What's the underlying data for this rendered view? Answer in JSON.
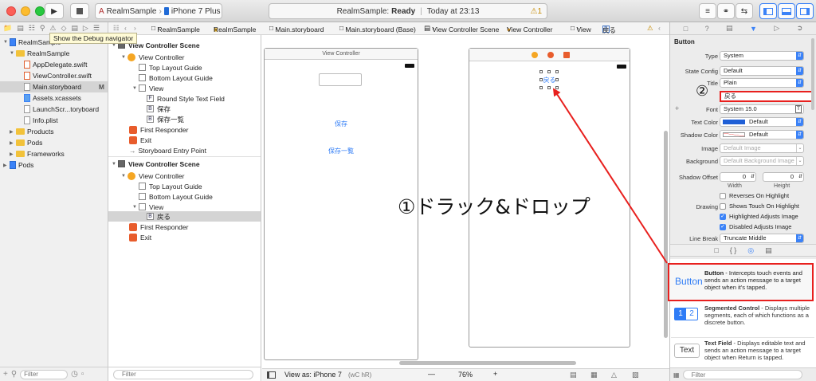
{
  "toolbar": {
    "scheme": "RealmSample",
    "device": "iPhone 7 Plus",
    "status_project": "RealmSample:",
    "status_state": "Ready",
    "status_sep": "|",
    "status_time": "Today at 23:13",
    "warnings": "1"
  },
  "tooltip": "Show the Debug navigator",
  "jumpbar": {
    "crumbs": [
      "RealmSample",
      "RealmSample",
      "Main.storyboard",
      "Main.storyboard (Base)",
      "View Controller Scene",
      "View Controller",
      "View",
      "戻る"
    ]
  },
  "navigator": {
    "items": [
      {
        "label": "RealmSample",
        "badge": ""
      },
      {
        "label": "RealmSample",
        "badge": ""
      },
      {
        "label": "AppDelegate.swift",
        "badge": ""
      },
      {
        "label": "ViewController.swift",
        "badge": ""
      },
      {
        "label": "Main.storyboard",
        "badge": "M"
      },
      {
        "label": "Assets.xcassets",
        "badge": ""
      },
      {
        "label": "LaunchScr...toryboard",
        "badge": ""
      },
      {
        "label": "Info.plist",
        "badge": ""
      },
      {
        "label": "Products",
        "badge": ""
      },
      {
        "label": "Pods",
        "badge": ""
      },
      {
        "label": "Frameworks",
        "badge": ""
      },
      {
        "label": "Pods",
        "badge": ""
      }
    ],
    "filter_placeholder": "Filter"
  },
  "outline": {
    "rows": [
      "View Controller Scene",
      "View Controller",
      "Top Layout Guide",
      "Bottom Layout Guide",
      "View",
      "Round Style Text Field",
      "保存",
      "保存一覧",
      "First Responder",
      "Exit",
      "Storyboard Entry Point",
      "View Controller Scene",
      "View Controller",
      "Top Layout Guide",
      "Bottom Layout Guide",
      "View",
      "戻る",
      "First Responder",
      "Exit"
    ],
    "filter_placeholder": "Filter"
  },
  "canvas": {
    "vc1_title": "View Controller",
    "btn_save": "保存",
    "btn_list": "保存一覧",
    "vc2_button": "戻る",
    "annotation_drag": "①ドラック&ドロップ",
    "annotation_two": "②"
  },
  "bottombar": {
    "view_as": "View as: iPhone 7",
    "view_as_keys": "(wC hR)",
    "minus": "—",
    "zoom": "76%",
    "plus": "+"
  },
  "inspector": {
    "section": "Button",
    "type_label": "Type",
    "type_value": "System",
    "state_label": "State Config",
    "state_value": "Default",
    "title_label": "Title",
    "title_value": "Plain",
    "title_text": "戻る",
    "font_label": "Font",
    "font_value": "System 15.0",
    "textcolor_label": "Text Color",
    "textcolor_value": "Default",
    "shadowcolor_label": "Shadow Color",
    "shadowcolor_value": "Default",
    "image_label": "Image",
    "image_placeholder": "Default Image",
    "background_label": "Background",
    "background_placeholder": "Default Background Image",
    "shadow_offset_label": "Shadow Offset",
    "shadow_w": "0",
    "shadow_h": "0",
    "width_label": "Width",
    "height_label": "Height",
    "drawing_label": "Drawing",
    "opt_reverses": "Reverses On Highlight",
    "opt_shows_touch": "Shows Touch On Highlight",
    "opt_highlighted": "Highlighted Adjusts Image",
    "opt_disabled": "Disabled Adjusts Image",
    "linebreak_label": "Line Break",
    "linebreak_value": "Truncate Middle",
    "text_color_swatch": "#1f5fd6"
  },
  "library": {
    "button_icon": "Button",
    "button_title": "Button",
    "button_desc": " - Intercepts touch events and sends an action message to a target object when it's tapped.",
    "seg_title": "Segmented Control",
    "seg_desc": " - Displays multiple segments, each of which functions as a discrete button.",
    "seg_1": "1",
    "seg_2": "2",
    "text_icon": "Text",
    "text_title": "Text Field",
    "text_desc": " - Displays editable text and sends an action message to a target object when Return is tapped.",
    "filter_placeholder": "Filter"
  },
  "colors": {
    "accent": "#3b82f7",
    "annotation_red": "#e8201e",
    "selection": "#d4d4d4"
  }
}
